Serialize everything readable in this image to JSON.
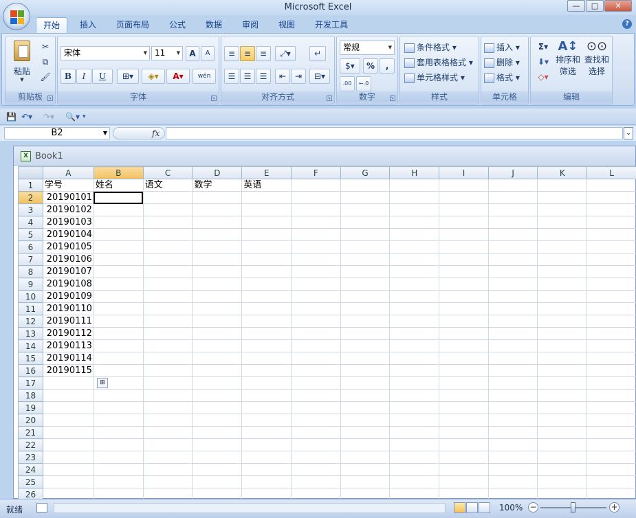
{
  "window": {
    "title": "Microsoft Excel",
    "minimize": "—",
    "maximize": "□",
    "close": "✕"
  },
  "tabs": [
    "开始",
    "插入",
    "页面布局",
    "公式",
    "数据",
    "审阅",
    "视图",
    "开发工具"
  ],
  "ribbon": {
    "clipboard": {
      "label": "剪贴板",
      "paste": "粘贴"
    },
    "font": {
      "label": "字体",
      "font_name": "宋体",
      "font_size": "11",
      "bold": "B",
      "italic": "I",
      "underline": "U",
      "grow": "A",
      "shrink": "A",
      "font_color": "A",
      "phonetic": "wén"
    },
    "alignment": {
      "label": "对齐方式"
    },
    "number": {
      "label": "数字",
      "format": "常规",
      "percent": "%",
      "comma": ",",
      "inc_decimal": ".00",
      "dec_decimal": "←.0"
    },
    "styles": {
      "label": "样式",
      "conditional": "条件格式",
      "table": "套用表格格式",
      "cell_styles": "单元格样式"
    },
    "cells": {
      "label": "单元格",
      "insert": "插入",
      "delete": "删除",
      "format": "格式"
    },
    "editing": {
      "label": "编辑",
      "sort_filter_1": "排序和",
      "sort_filter_2": "筛选",
      "find_1": "查找和",
      "find_2": "选择",
      "sum": "Σ"
    }
  },
  "formula_bar": {
    "name_box": "B2",
    "fx": "fx",
    "value": ""
  },
  "workbook": {
    "name": "Book1"
  },
  "sheet": {
    "columns": [
      "A",
      "B",
      "C",
      "D",
      "E",
      "F",
      "G",
      "H",
      "I",
      "J",
      "K",
      "L"
    ],
    "selected_column": "B",
    "selected_row": 2,
    "rows": [
      {
        "n": "1",
        "cells": [
          "学号",
          "姓名",
          "语文",
          "数学",
          "英语"
        ]
      },
      {
        "n": "2",
        "cells": [
          "20190101"
        ]
      },
      {
        "n": "3",
        "cells": [
          "20190102"
        ]
      },
      {
        "n": "4",
        "cells": [
          "20190103"
        ]
      },
      {
        "n": "5",
        "cells": [
          "20190104"
        ]
      },
      {
        "n": "6",
        "cells": [
          "20190105"
        ]
      },
      {
        "n": "7",
        "cells": [
          "20190106"
        ]
      },
      {
        "n": "8",
        "cells": [
          "20190107"
        ]
      },
      {
        "n": "9",
        "cells": [
          "20190108"
        ]
      },
      {
        "n": "10",
        "cells": [
          "20190109"
        ]
      },
      {
        "n": "11",
        "cells": [
          "20190110"
        ]
      },
      {
        "n": "12",
        "cells": [
          "20190111"
        ]
      },
      {
        "n": "13",
        "cells": [
          "20190112"
        ]
      },
      {
        "n": "14",
        "cells": [
          "20190113"
        ]
      },
      {
        "n": "15",
        "cells": [
          "20190114"
        ]
      },
      {
        "n": "16",
        "cells": [
          "20190115"
        ]
      },
      {
        "n": "17",
        "cells": []
      },
      {
        "n": "18",
        "cells": []
      },
      {
        "n": "19",
        "cells": []
      },
      {
        "n": "20",
        "cells": []
      },
      {
        "n": "21",
        "cells": []
      },
      {
        "n": "22",
        "cells": []
      },
      {
        "n": "23",
        "cells": []
      },
      {
        "n": "24",
        "cells": []
      },
      {
        "n": "25",
        "cells": []
      },
      {
        "n": "26",
        "cells": []
      }
    ]
  },
  "status": {
    "ready": "就绪",
    "zoom": "100%"
  }
}
